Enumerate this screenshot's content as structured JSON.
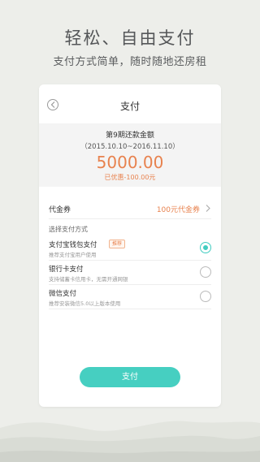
{
  "hero": {
    "title": "轻松、自由支付",
    "subtitle": "支付方式简单，随时随地还房租"
  },
  "card": {
    "title": "支付",
    "bill": {
      "title": "第9期还款金额",
      "period": "（2015.10.10~2016.11.10）",
      "amount": "5000.00",
      "discount": "已优惠-100.00元"
    },
    "coupon": {
      "label": "代金券",
      "value": "100元代金券"
    },
    "methods_label": "选择支付方式",
    "methods": [
      {
        "name": "支付宝钱包支付",
        "badge": "推荐",
        "desc": "推荐支付宝用户使用",
        "selected": true
      },
      {
        "name": "银行卡支付",
        "badge": "",
        "desc": "支持储蓄卡信用卡，无需开通网银",
        "selected": false
      },
      {
        "name": "微信支付",
        "badge": "",
        "desc": "推荐安装微信5.0以上版本使用",
        "selected": false
      }
    ],
    "pay_button": "支付"
  },
  "colors": {
    "accent": "#46cfc1",
    "highlight": "#e8824e",
    "background": "#edeeea"
  }
}
